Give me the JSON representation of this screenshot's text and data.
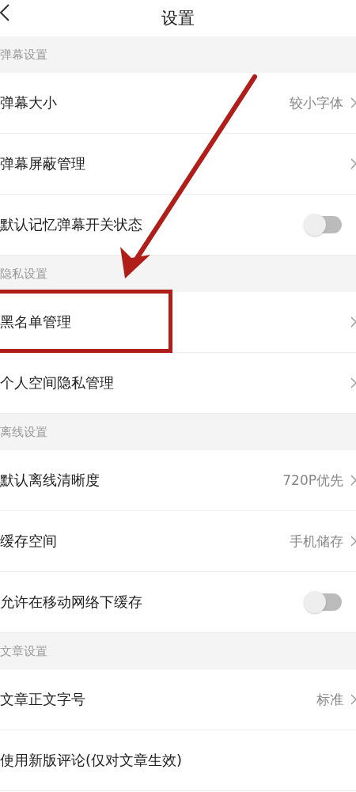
{
  "header": {
    "title": "设置"
  },
  "sections": [
    {
      "title": "弹幕设置",
      "items": [
        {
          "kind": "link",
          "label": "弹幕大小",
          "value": "较小字体",
          "highlighted": false
        },
        {
          "kind": "link",
          "label": "弹幕屏蔽管理",
          "highlighted": false
        },
        {
          "kind": "toggle",
          "label": "默认记忆弹幕开关状态",
          "on": false,
          "highlighted": false
        }
      ]
    },
    {
      "title": "隐私设置",
      "items": [
        {
          "kind": "link",
          "label": "黑名单管理",
          "highlighted": true
        },
        {
          "kind": "link",
          "label": "个人空间隐私管理",
          "highlighted": false
        }
      ]
    },
    {
      "title": "离线设置",
      "items": [
        {
          "kind": "link",
          "label": "默认离线清晰度",
          "value": "720P优先",
          "highlighted": false
        },
        {
          "kind": "link",
          "label": "缓存空间",
          "value": "手机储存",
          "highlighted": false
        },
        {
          "kind": "toggle",
          "label": "允许在移动网络下缓存",
          "on": false,
          "highlighted": false
        }
      ]
    },
    {
      "title": "文章设置",
      "items": [
        {
          "kind": "link",
          "label": "文章正文字号",
          "value": "标准",
          "highlighted": false
        },
        {
          "kind": "plain",
          "label": "使用新版评论(仅对文章生效)",
          "highlighted": false
        }
      ]
    }
  ]
}
